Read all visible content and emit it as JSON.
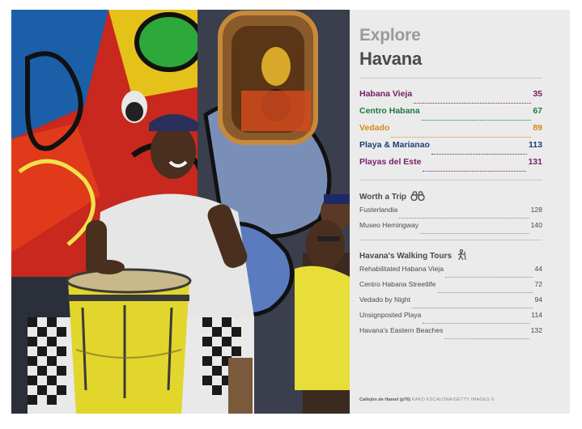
{
  "title": {
    "line1": "Explore",
    "line2": "Havana"
  },
  "main_toc": [
    {
      "label": "Habana Vieja",
      "page": "35",
      "color": "#6e1f5e"
    },
    {
      "label": "Centro Habana",
      "page": "67",
      "color": "#1a7a3c"
    },
    {
      "label": "Vedado",
      "page": "89",
      "color": "#d48a17"
    },
    {
      "label": "Playa & Marianao",
      "page": "113",
      "color": "#1c3f73"
    },
    {
      "label": "Playas del Este",
      "page": "131",
      "color": "#7a2068"
    }
  ],
  "worth_a_trip": {
    "heading": "Worth a Trip",
    "icon": "binoculars-icon",
    "items": [
      {
        "label": "Fusterlandia",
        "page": "128"
      },
      {
        "label": "Museo Hemingway",
        "page": "140"
      }
    ]
  },
  "walking_tours": {
    "heading": "Havana's Walking Tours",
    "icon": "walker-icon",
    "items": [
      {
        "label": "Rehabilitated Habana Vieja",
        "page": "44"
      },
      {
        "label": "Centro Habana Streetlife",
        "page": "72"
      },
      {
        "label": "Vedado by Night",
        "page": "94"
      },
      {
        "label": "Unsignposted Playa",
        "page": "114"
      },
      {
        "label": "Havana's Eastern Beaches",
        "page": "132"
      }
    ]
  },
  "caption": {
    "place": "Callejón de Hamel (p76)",
    "credit": "KAKO ESCALONA/GETTY IMAGES ©"
  }
}
